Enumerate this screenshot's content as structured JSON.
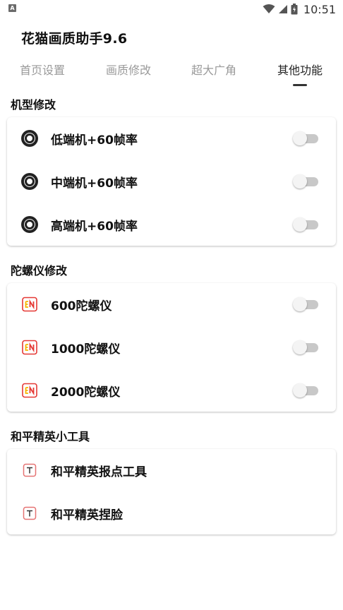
{
  "status_bar": {
    "time": "10:51",
    "left_icon_letter": "A"
  },
  "app": {
    "title": "花猫画质助手9.6"
  },
  "tabs": [
    {
      "label": "首页设置",
      "active": false
    },
    {
      "label": "画质修改",
      "active": false
    },
    {
      "label": "超大广角",
      "active": false
    },
    {
      "label": "其他功能",
      "active": true
    }
  ],
  "sections": [
    {
      "title": "机型修改",
      "items": [
        {
          "label": "低端机+60帧率",
          "icon": "disc-icon",
          "toggle": false
        },
        {
          "label": "中端机+60帧率",
          "icon": "disc-icon",
          "toggle": false
        },
        {
          "label": "高端机+60帧率",
          "icon": "disc-icon",
          "toggle": false
        }
      ]
    },
    {
      "title": "陀螺仪修改",
      "items": [
        {
          "label": "600陀螺仪",
          "icon": "en-icon",
          "toggle": false
        },
        {
          "label": "1000陀螺仪",
          "icon": "en-icon",
          "toggle": false
        },
        {
          "label": "2000陀螺仪",
          "icon": "en-icon",
          "toggle": false
        }
      ]
    },
    {
      "title": "和平精英小工具",
      "items": [
        {
          "label": "和平精英报点工具",
          "icon": "t-icon"
        },
        {
          "label": "和平精英捏脸",
          "icon": "t-icon"
        }
      ]
    }
  ],
  "colors": {
    "accent_red": "#e53935",
    "accent_yellow": "#f5b400",
    "switch_off_track": "#c8c8c8",
    "tab_inactive": "#9a9a9a"
  }
}
